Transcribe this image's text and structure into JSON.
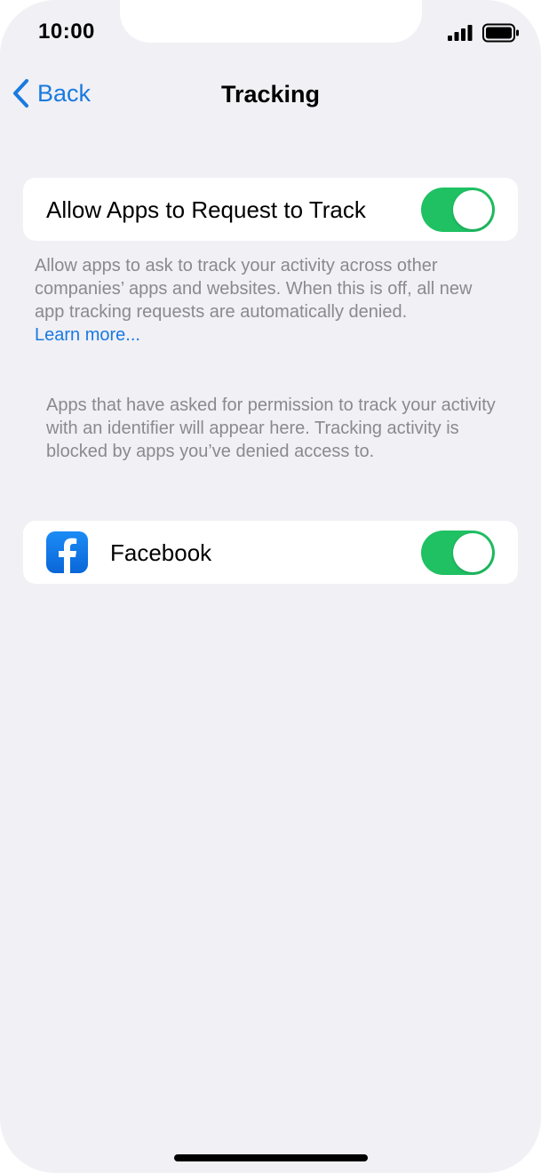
{
  "status_bar": {
    "time": "10:00"
  },
  "nav": {
    "back_label": "Back",
    "title": "Tracking"
  },
  "allow_tracking": {
    "label": "Allow Apps to Request to Track",
    "enabled": true,
    "footer": "Allow apps to ask to track your activity across other companies’ apps and websites. When this is off, all new app tracking requests are automatically denied.",
    "learn_more": "Learn more..."
  },
  "apps_info": "Apps that have asked for permission to track your activity with an identifier will appear here. Tracking activity is blocked by apps you’ve denied access to.",
  "apps": [
    {
      "name": "Facebook",
      "icon": "facebook-icon",
      "enabled": true
    }
  ],
  "colors": {
    "accent": "#1a7ae0",
    "toggle_on": "#1fc163",
    "background": "#f0f0f5",
    "secondary_text": "#8a8a8e"
  }
}
